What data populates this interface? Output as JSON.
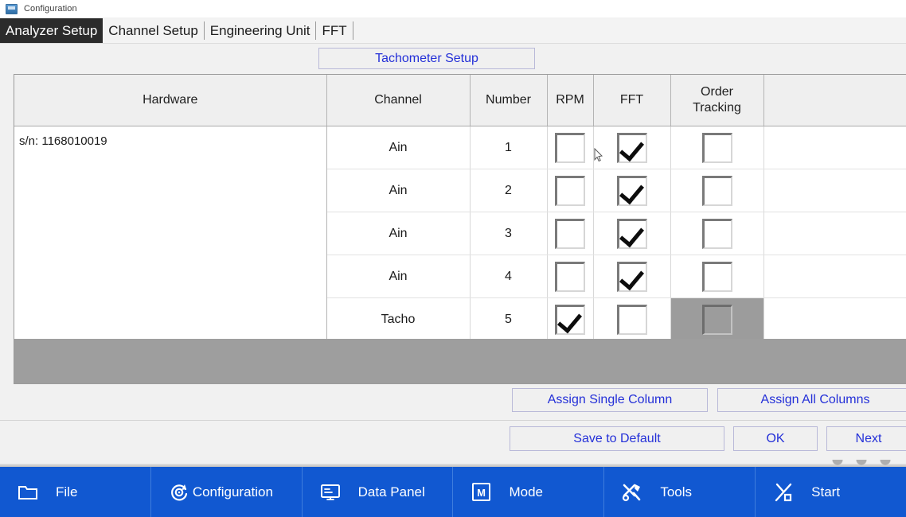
{
  "window": {
    "title": "Configuration",
    "icon": "app-icon"
  },
  "tabs": [
    {
      "label": "Analyzer Setup",
      "active": true
    },
    {
      "label": "Channel Setup",
      "active": false
    },
    {
      "label": "Engineering Unit",
      "active": false
    },
    {
      "label": "FFT",
      "active": false
    }
  ],
  "tachometer_button": {
    "label": "Tachometer Setup"
  },
  "table": {
    "headers": [
      "Hardware",
      "Channel",
      "Number",
      "RPM",
      "FFT",
      "Order Tracking",
      ""
    ],
    "hardware_label": "s/n: 1168010019",
    "rows": [
      {
        "channel": "Ain",
        "number": "1",
        "rpm": false,
        "fft": true,
        "order_tracking": false,
        "order_tracking_disabled": false
      },
      {
        "channel": "Ain",
        "number": "2",
        "rpm": false,
        "fft": true,
        "order_tracking": false,
        "order_tracking_disabled": false
      },
      {
        "channel": "Ain",
        "number": "3",
        "rpm": false,
        "fft": true,
        "order_tracking": false,
        "order_tracking_disabled": false
      },
      {
        "channel": "Ain",
        "number": "4",
        "rpm": false,
        "fft": true,
        "order_tracking": false,
        "order_tracking_disabled": false
      },
      {
        "channel": "Tacho",
        "number": "5",
        "rpm": true,
        "fft": false,
        "order_tracking": false,
        "order_tracking_disabled": true
      }
    ]
  },
  "actions": {
    "assign_single": "Assign Single Column",
    "assign_all": "Assign All Columns",
    "save_default": "Save to Default",
    "ok": "OK",
    "next": "Next"
  },
  "toolbar": {
    "items": [
      {
        "label": "File",
        "icon": "folder-icon"
      },
      {
        "label": "Configuration",
        "icon": "gear-refresh-icon"
      },
      {
        "label": "Data Panel",
        "icon": "monitor-icon"
      },
      {
        "label": "Mode",
        "icon": "mode-m-icon"
      },
      {
        "label": "Tools",
        "icon": "tools-icon"
      },
      {
        "label": "Start",
        "icon": "start-slash-icon"
      }
    ]
  },
  "colors": {
    "toolbar_blue": "#1158d1",
    "button_text_blue": "#2430d8",
    "active_tab_bg": "#2b2b2b",
    "disabled_gray": "#9c9c9c",
    "strip_gray": "#9e9e9e"
  }
}
